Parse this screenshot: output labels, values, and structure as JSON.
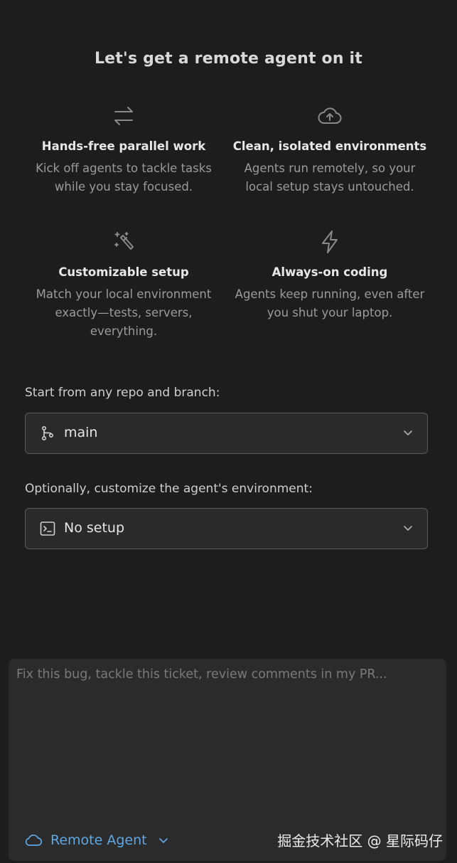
{
  "title": "Let's get a remote agent on it",
  "features": [
    {
      "icon": "arrows-swap-icon",
      "title": "Hands-free parallel work",
      "desc_lines": [
        "Kick off agents to tackle tasks",
        "while you stay focused."
      ]
    },
    {
      "icon": "cloud-upload-icon",
      "title": "Clean, isolated environments",
      "desc_lines": [
        "Agents run remotely, so your",
        "local setup stays untouched."
      ]
    },
    {
      "icon": "magic-wand-icon",
      "title": "Customizable setup",
      "desc_lines": [
        "Match your local environment",
        "exactly—tests, servers,",
        "everything."
      ]
    },
    {
      "icon": "lightning-icon",
      "title": "Always-on coding",
      "desc_lines": [
        "Agents keep running, even after",
        "you shut your laptop."
      ]
    }
  ],
  "repo": {
    "label": "Start from any repo and branch:",
    "value": "main",
    "icon": "git-branch-icon"
  },
  "environment": {
    "label": "Optionally, customize the agent's environment:",
    "value": "No setup",
    "icon": "terminal-icon"
  },
  "composer": {
    "placeholder": "Fix this bug, tackle this ticket, review comments in my PR...",
    "value": "",
    "agent_label": "Remote Agent",
    "agent_icon": "cloud-icon"
  },
  "watermark": "掘金技术社区 @ 星际码仔",
  "colors": {
    "background": "#1d1d1d",
    "panel": "#2a2a2a",
    "accent": "#5fa8e6",
    "muted_text": "#9b9b9b"
  }
}
